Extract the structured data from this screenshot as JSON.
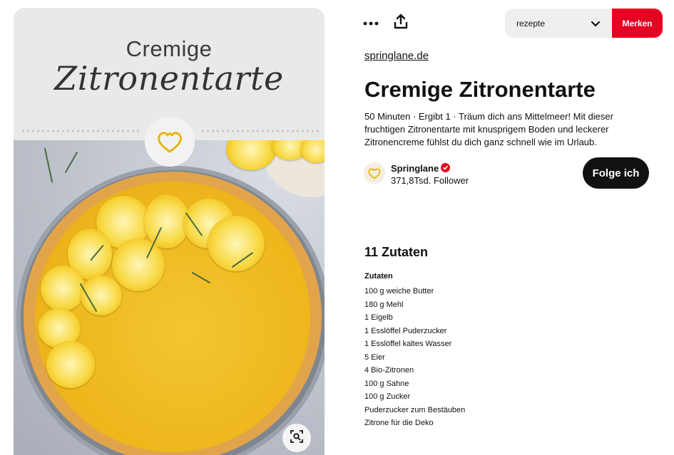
{
  "pin": {
    "title_line1": "Cremige",
    "title_line2": "Zitronentarte"
  },
  "toolbar": {
    "more_icon": "more-dots-icon",
    "share_icon": "share-icon",
    "board_value": "rezepte",
    "save_label": "Merken"
  },
  "source": {
    "link": "springlane.de"
  },
  "recipe": {
    "title": "Cremige Zitronentarte",
    "description": "50 Minuten · Ergibt 1 · Träum dich ans Mittelmeer! Mit dieser fruchtigen Zitronentarte mit knusprigem Boden und leckerer Zitronencreme fühlst du dich ganz schnell wie im Urlaub."
  },
  "creator": {
    "name": "Springlane",
    "followers": "371,8Tsd. Follower",
    "follow_label": "Folge ich"
  },
  "ingredients": {
    "heading": "11 Zutaten",
    "subheading": "Zutaten",
    "items": [
      "100 g weiche Butter",
      "180 g Mehl",
      "1 Eigelb",
      "1 Esslöffel Puderzucker",
      "1 Esslöffel kaltes Wasser",
      "5 Eier",
      "4 Bio-Zitronen",
      "100 g Sahne",
      "100 g Zucker",
      "Puderzucker zum Bestäuben",
      "Zitrone für die Deko"
    ]
  },
  "colors": {
    "accent": "#e60023",
    "follow_bg": "#111111",
    "select_bg": "#efefef"
  }
}
